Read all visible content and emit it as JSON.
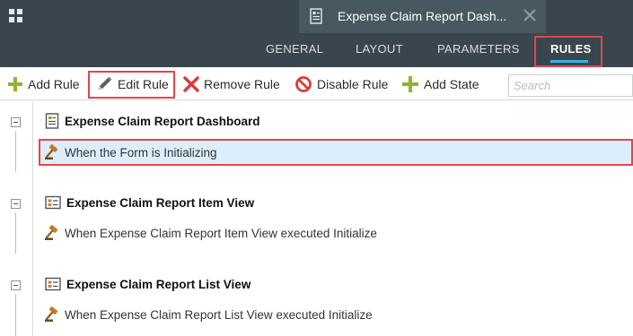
{
  "header": {
    "document_tab_title": "Expense Claim Report Dash...",
    "nav_tabs": [
      {
        "label": "GENERAL"
      },
      {
        "label": "LAYOUT"
      },
      {
        "label": "PARAMETERS"
      },
      {
        "label": "RULES",
        "active": true
      }
    ],
    "accent_color": "#38b2e6"
  },
  "toolbar": {
    "buttons": [
      {
        "label": "Add Rule",
        "icon": "plus-icon"
      },
      {
        "label": "Edit Rule",
        "icon": "pencil-icon"
      },
      {
        "label": "Remove Rule",
        "icon": "x-icon"
      },
      {
        "label": "Disable Rule",
        "icon": "ban-icon"
      },
      {
        "label": "Add State",
        "icon": "plus-icon"
      }
    ],
    "search_placeholder": "Search"
  },
  "groups": [
    {
      "title": "Expense Claim Report Dashboard",
      "icon": "form-icon",
      "rules": [
        {
          "label": "When the Form is Initializing",
          "icon": "gavel-icon",
          "selected": true
        }
      ]
    },
    {
      "title": "Expense Claim Report Item View",
      "icon": "view-icon",
      "rules": [
        {
          "label": "When Expense Claim Report Item View executed Initialize",
          "icon": "gavel-icon"
        }
      ]
    },
    {
      "title": "Expense Claim Report List View",
      "icon": "view-icon",
      "rules": [
        {
          "label": "When Expense Claim Report List View executed Initialize",
          "icon": "gavel-icon"
        }
      ]
    }
  ],
  "highlight_color": "#e0474c"
}
